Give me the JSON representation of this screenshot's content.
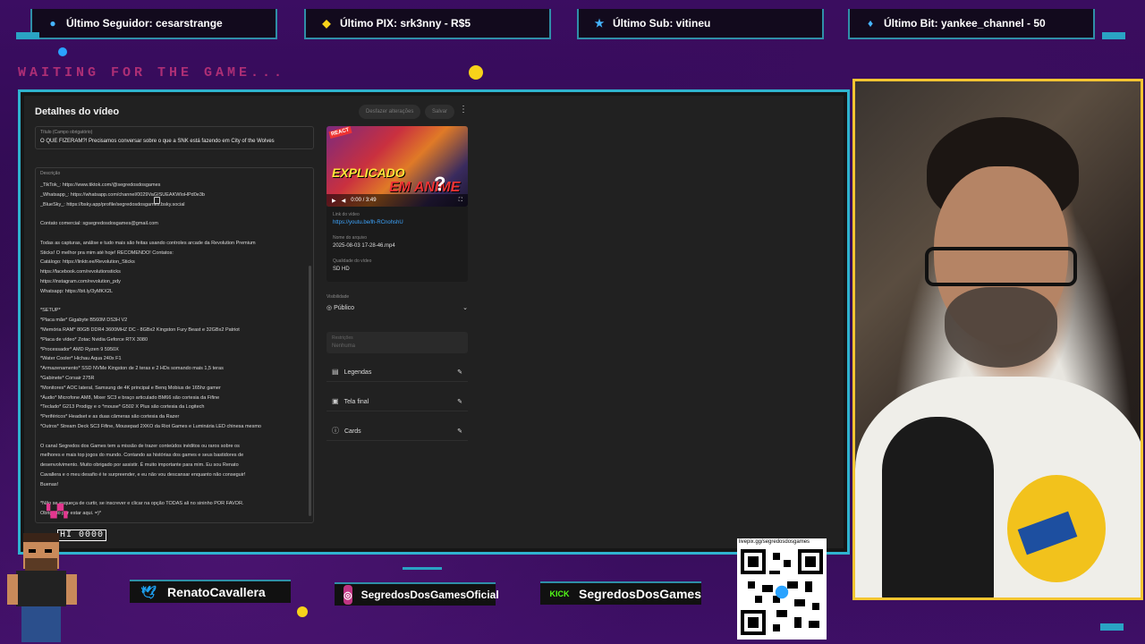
{
  "top_bar": {
    "follower": "Último Seguidor: cesarstrange",
    "pix": "Último PIX: srk3nny - R$5",
    "sub": "Último Sub: vitineu",
    "bit": "Último Bit: yankee_channel - 50"
  },
  "waiting_text": "WAITING FOR THE GAME...",
  "studio": {
    "header": "Detalhes do vídeo",
    "undo_label": "Desfazer alterações",
    "save_label": "Salvar",
    "title_label": "Título (Campo obrigatório)",
    "title_value": "O QUE FIZERAM?! Precisamos conversar sobre o que a SNK está fazendo em City of the Wolves",
    "desc_label": "Descrição",
    "description_lines": [
      "_TikTok_: https://www.tiktok.com/@segredosdosgames",
      "_Whatsapp_: https://whatsapp.com/channel/0029VaGISUEAKWIoHPd0e3b",
      "_BlueSky_: https://bsky.app/profile/segredosdosgames.bsky.social",
      "",
      "Contato comercial: sgsegredosdosgames@gmail.com",
      "",
      "Todas as capturas, análise e tudo mais são feitas usando controles arcade da Revolution Premium",
      "Sticks! O melhor pra mim até hoje! RECOMENDO! Contatos:",
      "Catálogo: https://linktr.ee/Revolution_Sticks",
      "https://facebook.com/revolutionsticks",
      "https://instagram.com/revolution_pdy",
      "Whatsapp: https://bit.ly/3yMKX2L",
      "",
      "*SETUP*",
      "*Placa mãe* Gigabyte B560M DS3H V2",
      "*Memória RAM* 80GB DDR4 3600MHZ DC - 8GBx2 Kingston Fury Beast e 32GBx2 Patriot",
      "*Placa de vídeo* Zotac Nvidia Geforce RTX 3080",
      "*Processador* AMD Ryzen 9 5950X",
      "*Water Cooler* Hichau Aqua 240x F1",
      "*Armazenamento* SSD NVMe Kingston de 2 teras e 2 HDs somando mais 1,5 teras",
      "*Gabinete* Corsair 275R",
      "*Monitores* AOC lateral, Samsung de 4K principal e Benq Mobius de 165hz gamer",
      "*Áudio* Microfone AM8, Mixer SC3 e braço articulado BM66 são cortesia da Fifine",
      "*Teclado* G213 Prodigy e o *mouse* G502 X Plus são cortesia da Logitech",
      "*Periféricos* Headset e as duas câmeras são cortesia da Razer",
      "*Outros* Stream Deck SC3 Fifine, Mousepad 2XKO da Riot Games e Luminária LED chinesa mesmo",
      "",
      "O canal Segredos dos Games tem a missão de trazer conteúdos inéditos ou raros sobre os",
      "melhores e mais top jogos do mundo. Contando as histórias dos games e seus bastidores de",
      "desenvolvimento. Muito obrigado por assistir. É muito importante para mim. Eu sou Renato",
      "Cavallera e o meu desafio é te surpreender, e eu não vou descansar enquanto não conseguir!",
      "Buenas!",
      "",
      "*Não se esqueça de curtir, se inscrever e clicar na opção TODAS ali no sininho POR FAVOR.",
      "Obrigado por estar aqui. =)*"
    ],
    "thumb_react": "REACT",
    "thumb_text": "EXPLICADO",
    "thumb_text2": "EM ANIME",
    "thumb_q": "?",
    "player_time": "0:00 / 3:49",
    "link_label": "Link do vídeo",
    "link_value": "https://youtu.be/lh-RCnohshU",
    "filename_label": "Nome do arquivo",
    "filename_value": "2025-08-03 17-28-46.mp4",
    "quality_label": "Qualidade do vídeo",
    "quality_value": "SD HD",
    "visibility_label": "Visibilidade",
    "visibility_value": "Público",
    "restrictions_label": "Restrições",
    "restrictions_value": "Nenhuma",
    "options": [
      "Legendas",
      "Tela final",
      "Cards"
    ]
  },
  "socials": {
    "twitter": "RenatoCavallera",
    "instagram": "SegredosDosGamesOficial",
    "kick": "SegredosDosGames",
    "kick_logo": "KICK"
  },
  "qr_caption": "livepix.gg/segredosdosgames",
  "hiscore": "HI 0000",
  "colors": {
    "accent_cyan": "#2fb3cf",
    "cam_border": "#f4c531",
    "bg_purple": "#3b0d62"
  }
}
